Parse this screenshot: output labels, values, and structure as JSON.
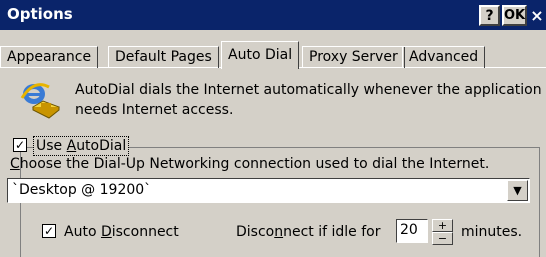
{
  "window": {
    "title": "Options",
    "help_label": "?",
    "ok_label": "OK",
    "close_label": "×"
  },
  "tabs": [
    {
      "label": "Appearance",
      "active": false
    },
    {
      "label": "Default Pages",
      "active": false
    },
    {
      "label": "Auto Dial",
      "active": true
    },
    {
      "label": "Proxy Server",
      "active": false
    },
    {
      "label": "Advanced",
      "active": false
    }
  ],
  "info": {
    "icon": "internet-explorer-dialup-icon",
    "text": "AutoDial dials the Internet automatically whenever the application needs Internet access."
  },
  "autodial": {
    "checkbox_checked": true,
    "label_pre": "Use ",
    "label_access": "A",
    "label_post": "utoDial",
    "choose_access": "C",
    "choose_text": "hoose the Dial-Up Networking connection used to dial the Internet.",
    "connection_value": "`Desktop @ 19200`"
  },
  "disconnect": {
    "checkbox_checked": true,
    "label_pre": "Auto ",
    "label_access": "D",
    "label_post": "isconnect",
    "idle_pre": "Disco",
    "idle_access": "n",
    "idle_post": "nect if idle for",
    "idle_value": "20",
    "minutes_label": "minutes."
  },
  "colors": {
    "titlebar": "#0a246a",
    "face": "#d4d0c8"
  }
}
